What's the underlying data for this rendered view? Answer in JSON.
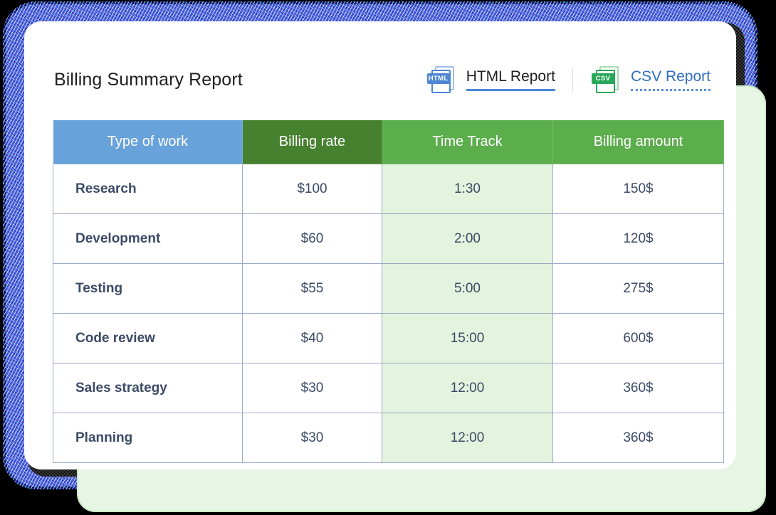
{
  "header": {
    "title": "Billing Summary Report",
    "links": [
      {
        "id": "html",
        "label": "HTML Report",
        "icon": "html-file-icon",
        "badge": "HTML",
        "color": "#4d87d4"
      },
      {
        "id": "csv",
        "label": "CSV Report",
        "icon": "csv-file-icon",
        "badge": "CSV",
        "color": "#2aa65a"
      }
    ]
  },
  "table": {
    "columns": [
      {
        "label": "Type of work",
        "bg": "#68a2db"
      },
      {
        "label": "Billing rate",
        "bg": "#46812f"
      },
      {
        "label": "Time Track",
        "bg": "#5cad4c"
      },
      {
        "label": "Billing amount",
        "bg": "#5cad4c"
      }
    ],
    "rows": [
      {
        "type": "Research",
        "rate": "$100",
        "time": "1:30",
        "amount": "150$"
      },
      {
        "type": "Development",
        "rate": "$60",
        "time": "2:00",
        "amount": "120$"
      },
      {
        "type": "Testing",
        "rate": "$55",
        "time": "5:00",
        "amount": "275$"
      },
      {
        "type": "Code review",
        "rate": "$40",
        "time": "15:00",
        "amount": "600$"
      },
      {
        "type": "Sales strategy",
        "rate": "$30",
        "time": "12:00",
        "amount": "360$"
      },
      {
        "type": "Planning",
        "rate": "$30",
        "time": "12:00",
        "amount": "360$"
      }
    ]
  },
  "theme": {
    "time_column_tint": "#e3f3dd",
    "text_color": "#3b4a66",
    "border_color": "#9aaac8",
    "accent_blue": "#4d87d4",
    "accent_green": "#2aa65a",
    "back_card_green": "#e7f6e4",
    "frame_navy": "#141a78"
  }
}
